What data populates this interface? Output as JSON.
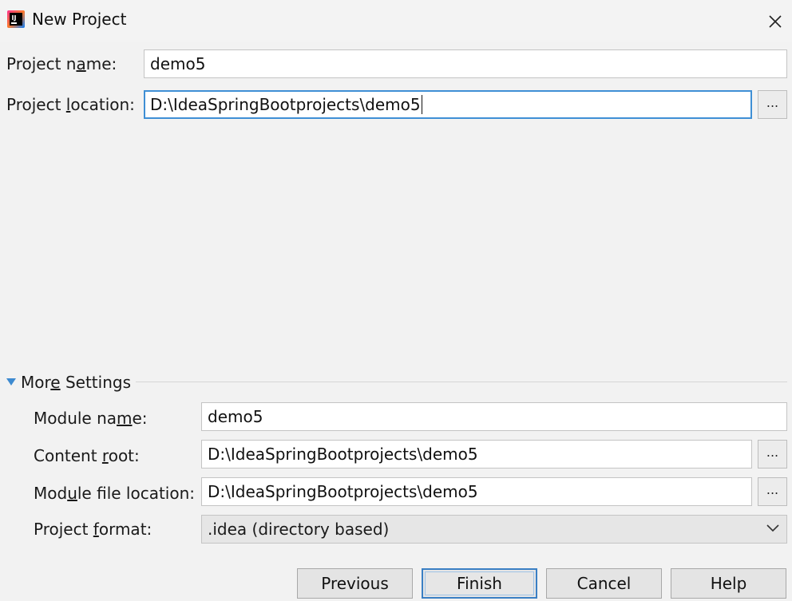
{
  "window": {
    "title": "New Project",
    "app_icon": "intellij-idea-icon",
    "close_icon": "close-icon"
  },
  "project": {
    "name_label_pre": "Project n",
    "name_label_mn": "a",
    "name_label_post": "me:",
    "name_value": "demo5",
    "location_label_pre": "Project ",
    "location_label_mn": "l",
    "location_label_post": "ocation:",
    "location_value": "D:\\IdeaSpringBootprojects\\demo5",
    "browse_label": "..."
  },
  "more_settings": {
    "label_pre": "Mor",
    "label_mn": "e",
    "label_post": " Settings",
    "expanded": true,
    "accent": "#3d8ad0",
    "module_name_label_pre": "Module na",
    "module_name_label_mn": "m",
    "module_name_label_post": "e:",
    "module_name_value": "demo5",
    "content_root_label_pre": "Content ",
    "content_root_label_mn": "r",
    "content_root_label_post": "oot:",
    "content_root_value": "D:\\IdeaSpringBootprojects\\demo5",
    "module_file_label_pre": "Mod",
    "module_file_label_mn": "u",
    "module_file_label_post": "le file location:",
    "module_file_value": "D:\\IdeaSpringBootprojects\\demo5",
    "format_label_pre": "Project ",
    "format_label_mn": "f",
    "format_label_post": "ormat:",
    "format_value": ".idea (directory based)",
    "browse_label": "..."
  },
  "buttons": {
    "previous": "Previous",
    "finish": "Finish",
    "cancel": "Cancel",
    "help": "Help"
  }
}
